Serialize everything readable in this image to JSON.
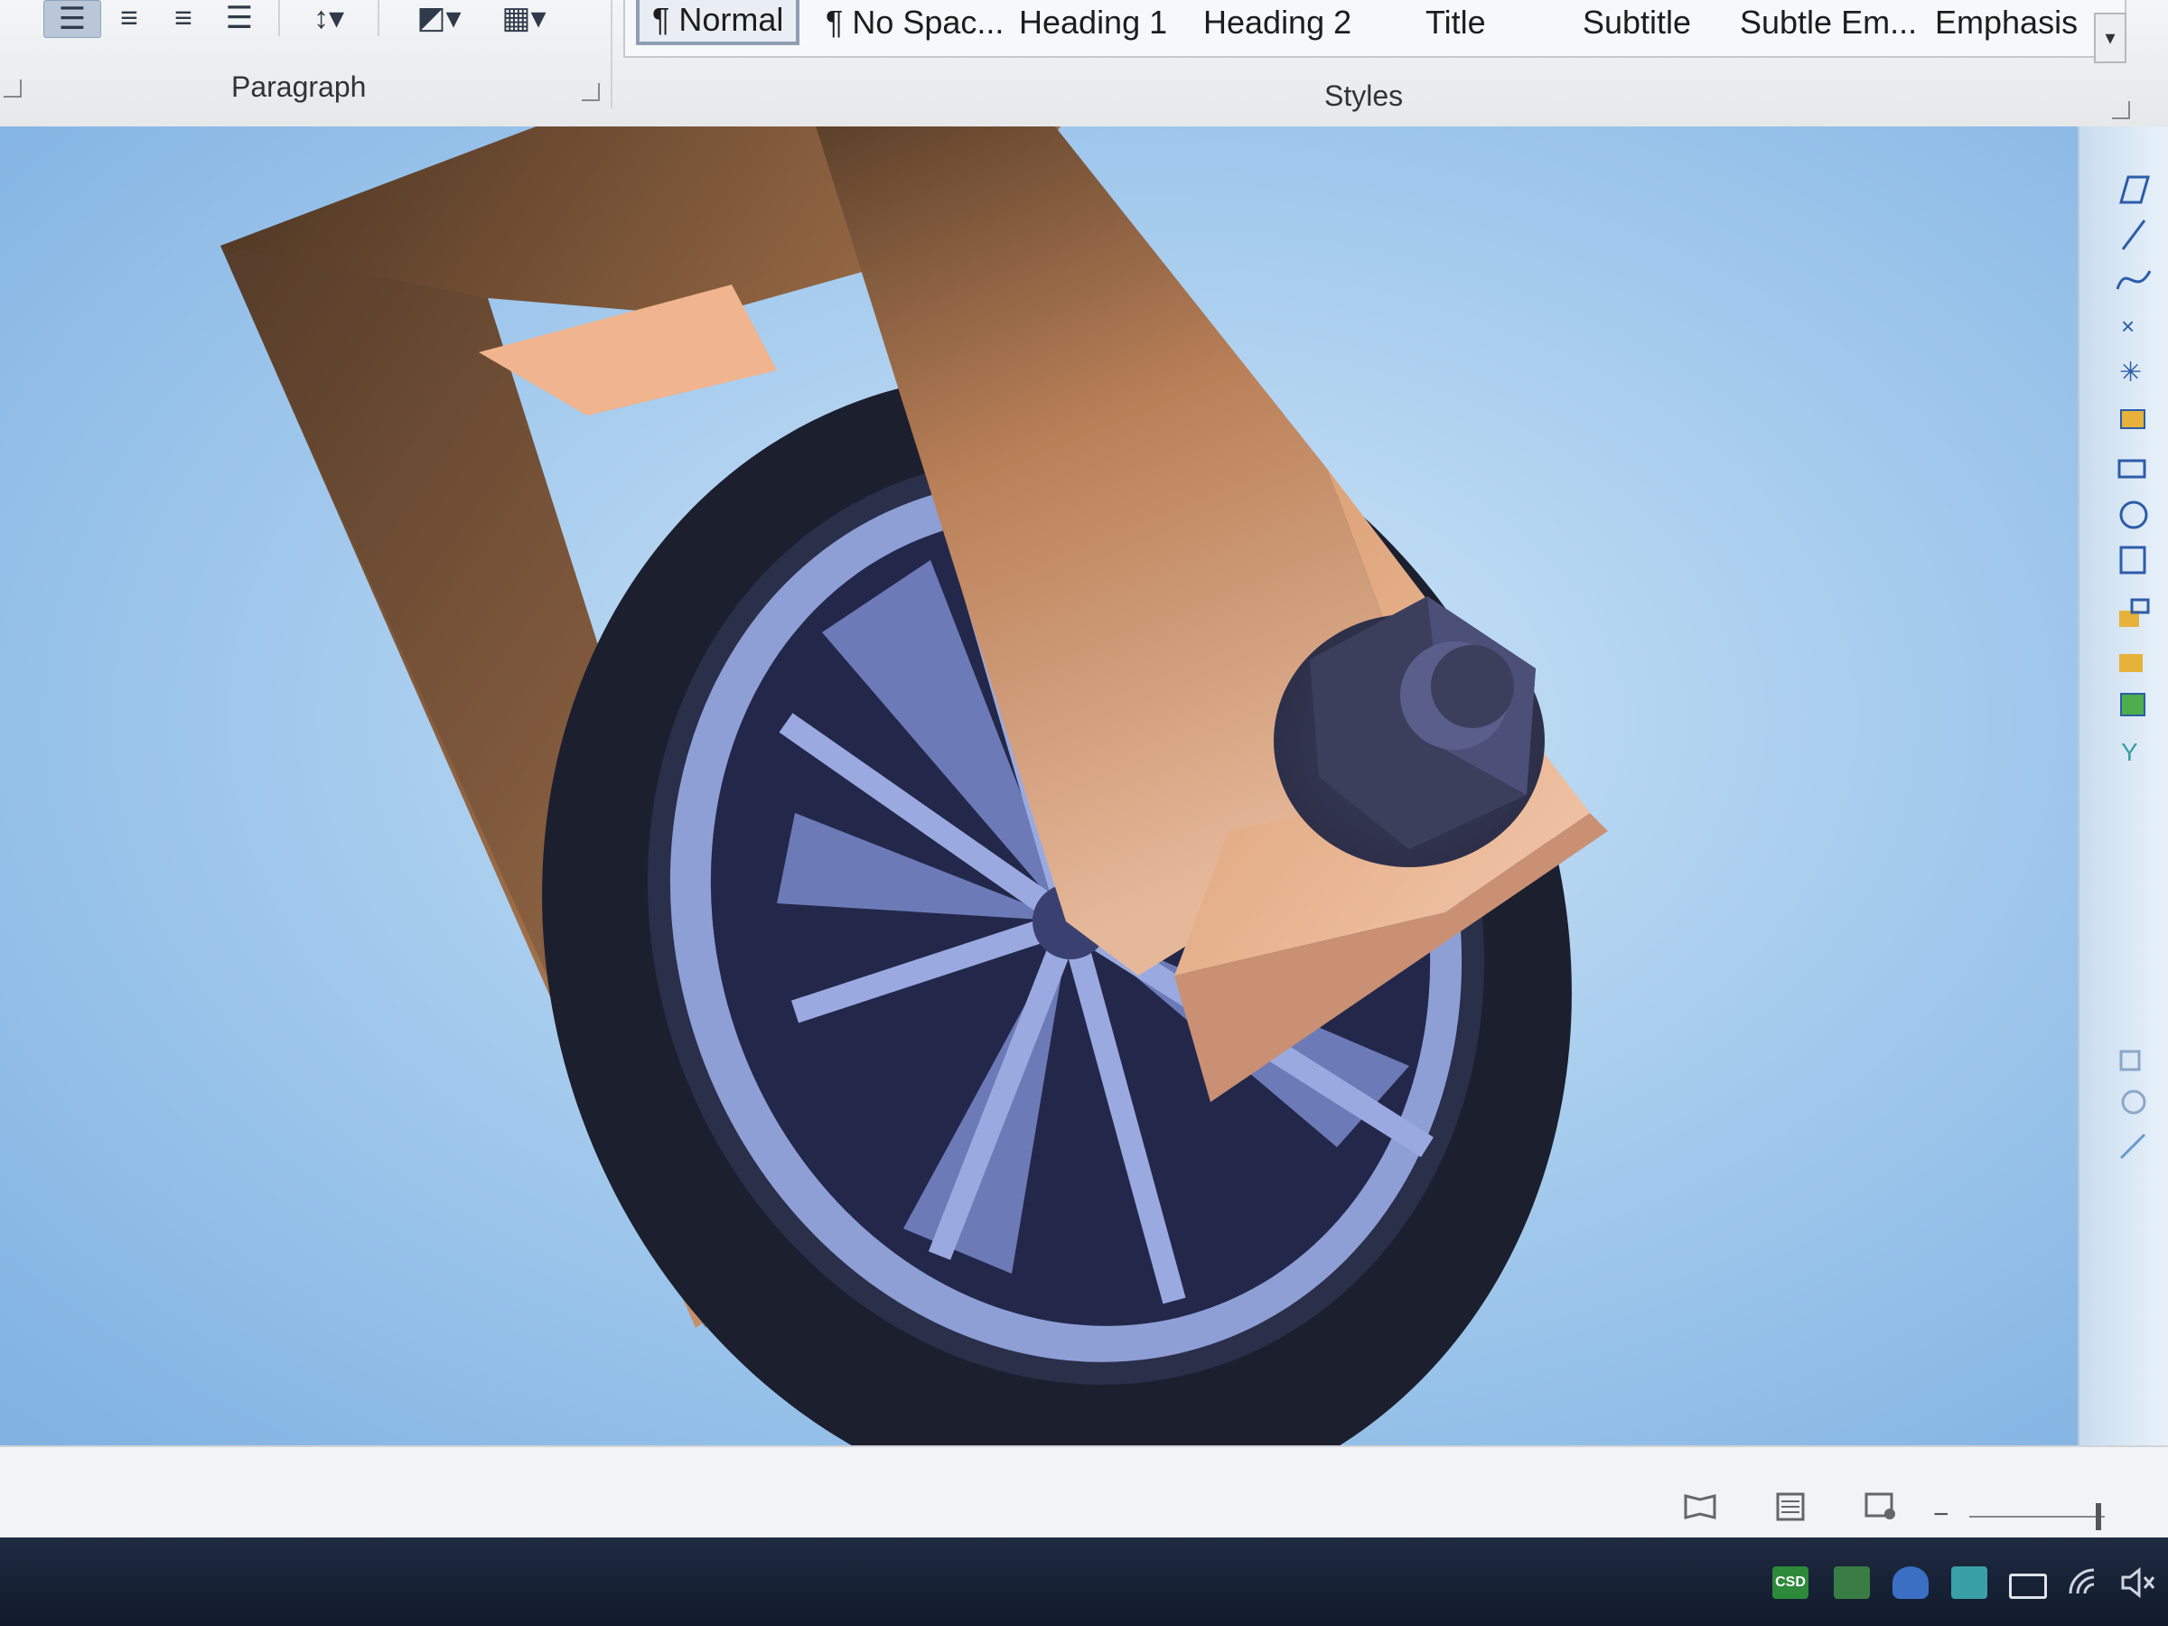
{
  "ribbon": {
    "paragraph_label": "Paragraph",
    "styles_label": "Styles",
    "styles": [
      {
        "label": "¶ Normal",
        "selected": true
      },
      {
        "label": "¶ No Spac...",
        "selected": false
      },
      {
        "label": "Heading 1",
        "selected": false
      },
      {
        "label": "Heading 2",
        "selected": false
      },
      {
        "label": "Title",
        "selected": false
      },
      {
        "label": "Subtitle",
        "selected": false
      },
      {
        "label": "Subtle Em...",
        "selected": false
      },
      {
        "label": "Emphasis",
        "selected": false
      }
    ]
  },
  "taskbar": {
    "csd_label": "CSD"
  },
  "colors": {
    "canvas_sky": "#a8cdee",
    "bracket_wood": "#d99a6c",
    "tire": "#1c1f2e",
    "rim": "#8e9fd6",
    "bolt": "#3c3f5c",
    "accent_selected": "#8f9fb3"
  },
  "icons": [
    "align-left-icon",
    "align-center-icon",
    "align-right-icon",
    "justify-icon",
    "line-spacing-icon",
    "shading-icon",
    "borders-icon",
    "reading-view-icon",
    "print-layout-icon",
    "web-layout-icon",
    "network-icon",
    "shield-icon",
    "volume-muted-icon",
    "battery-icon"
  ]
}
